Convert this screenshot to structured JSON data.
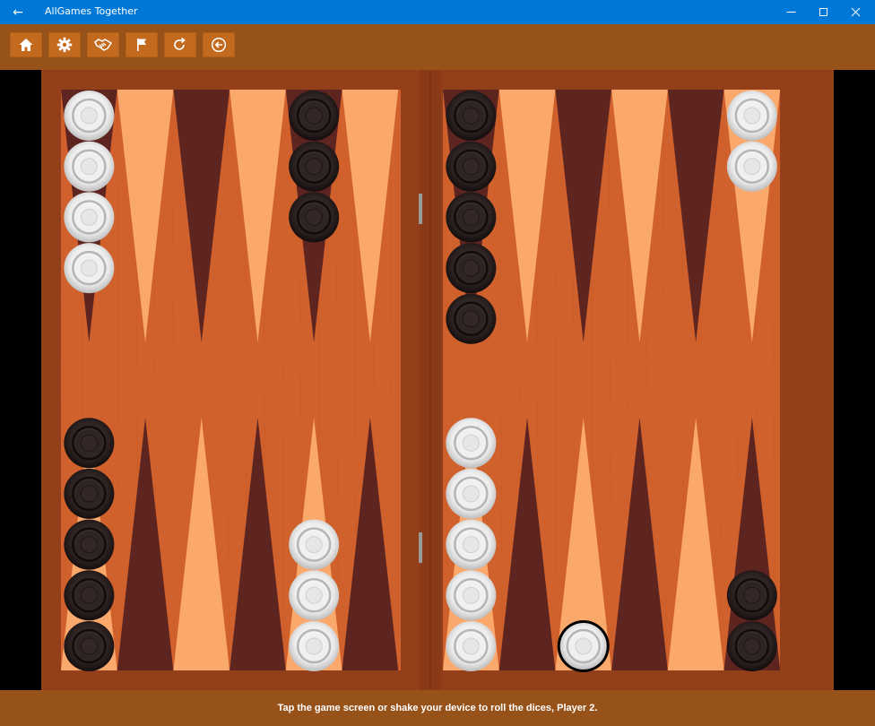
{
  "window": {
    "title": "AllGames Together",
    "back_icon": "arrow-left-icon",
    "controls": [
      "minimize-icon",
      "maximize-icon",
      "close-icon"
    ]
  },
  "toolbar": {
    "buttons": [
      {
        "icon": "home-icon"
      },
      {
        "icon": "gear-icon"
      },
      {
        "icon": "handshake-icon"
      },
      {
        "icon": "flag-icon"
      },
      {
        "icon": "redo-icon"
      },
      {
        "icon": "circle-arrow-left-icon"
      }
    ]
  },
  "colors": {
    "titlebar": "#0078d7",
    "toolbar": "#97521a",
    "frame": "#93401a",
    "felt": "#d0612c",
    "point_light": "#fba86c",
    "point_dark": "#5e2420",
    "checker_white": "#e9e9e9",
    "checker_black": "#2f2424"
  },
  "board": {
    "top_points": [
      {
        "white": 4,
        "black": 0
      },
      {
        "white": 0,
        "black": 0
      },
      {
        "white": 0,
        "black": 0
      },
      {
        "white": 0,
        "black": 0
      },
      {
        "white": 0,
        "black": 3
      },
      {
        "white": 0,
        "black": 0
      },
      {
        "white": 0,
        "black": 5
      },
      {
        "white": 0,
        "black": 0
      },
      {
        "white": 0,
        "black": 0
      },
      {
        "white": 0,
        "black": 0
      },
      {
        "white": 0,
        "black": 0
      },
      {
        "white": 2,
        "black": 0
      }
    ],
    "bottom_points": [
      {
        "white": 0,
        "black": 5
      },
      {
        "white": 0,
        "black": 0
      },
      {
        "white": 0,
        "black": 0
      },
      {
        "white": 0,
        "black": 0
      },
      {
        "white": 3,
        "black": 0
      },
      {
        "white": 0,
        "black": 0
      },
      {
        "white": 5,
        "black": 0
      },
      {
        "white": 0,
        "black": 0
      },
      {
        "white": 1,
        "black": 0,
        "selected": true
      },
      {
        "white": 0,
        "black": 0
      },
      {
        "white": 0,
        "black": 0
      },
      {
        "white": 0,
        "black": 2
      }
    ]
  },
  "status": {
    "message": "Tap the game screen or shake your device to roll the dices, Player 2."
  }
}
